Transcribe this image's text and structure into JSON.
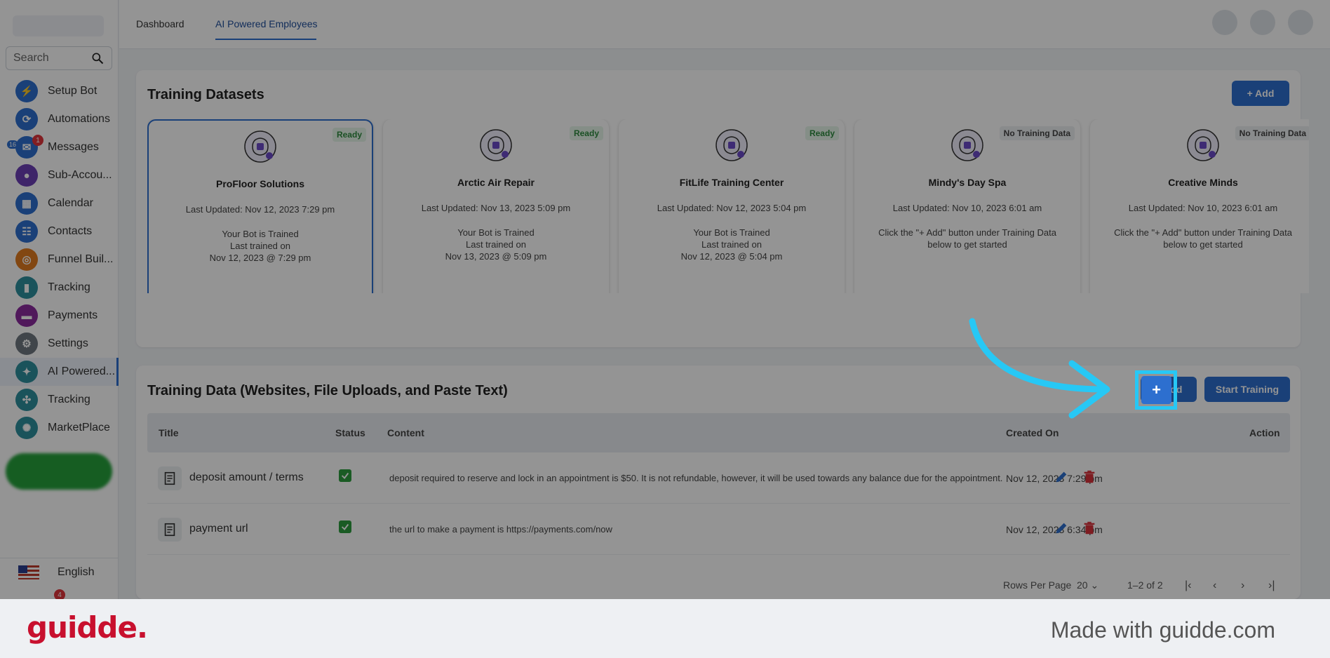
{
  "sidebar": {
    "search_placeholder": "Search",
    "items": [
      {
        "label": "Setup Bot",
        "icon": "bolt-icon",
        "color": "#2d6fcf",
        "glyph": "⚡"
      },
      {
        "label": "Automations",
        "icon": "automation-icon",
        "color": "#2d6fcf",
        "glyph": "⟳"
      },
      {
        "label": "Messages",
        "icon": "messages-icon",
        "color": "#2d6fcf",
        "glyph": "✉",
        "badge": "1",
        "badge2": "16"
      },
      {
        "label": "Sub-Accou...",
        "icon": "user-icon",
        "color": "#6b3fb5",
        "glyph": "●"
      },
      {
        "label": "Calendar",
        "icon": "calendar-icon",
        "color": "#2d6fcf",
        "glyph": "▦"
      },
      {
        "label": "Contacts",
        "icon": "contacts-icon",
        "color": "#2d6fcf",
        "glyph": "☷"
      },
      {
        "label": "Funnel Buil...",
        "icon": "funnel-icon",
        "color": "#e07b1f",
        "glyph": "◎"
      },
      {
        "label": "Tracking",
        "icon": "chart-icon",
        "color": "#2d8f9e",
        "glyph": "▮"
      },
      {
        "label": "Payments",
        "icon": "card-icon",
        "color": "#8a2a9e",
        "glyph": "▬"
      },
      {
        "label": "Settings",
        "icon": "gear-icon",
        "color": "#6e7780",
        "glyph": "⚙"
      },
      {
        "label": "AI Powered...",
        "icon": "chat-icon",
        "color": "#2d8f9e",
        "glyph": "✦",
        "active": true
      },
      {
        "label": "Tracking",
        "icon": "network-icon",
        "color": "#2d8f9e",
        "glyph": "✣"
      },
      {
        "label": "MarketPlace",
        "icon": "bulb-icon",
        "color": "#2d8f9e",
        "glyph": "✺"
      }
    ],
    "language": "English",
    "bottom_badge": "4"
  },
  "topbar": {
    "tabs": [
      "Dashboard",
      "AI Powered Employees"
    ]
  },
  "datasets": {
    "title": "Training Datasets",
    "add_label": "+ Add",
    "cards": [
      {
        "name": "ProFloor Solutions",
        "status": "Ready",
        "updated": "Last Updated: Nov 12, 2023 7:29 pm",
        "desc": "Your Bot is Trained\nLast trained on\nNov 12, 2023 @ 7:29 pm"
      },
      {
        "name": "Arctic Air Repair",
        "status": "Ready",
        "updated": "Last Updated: Nov 13, 2023 5:09 pm",
        "desc": "Your Bot is Trained\nLast trained on\nNov 13, 2023 @ 5:09 pm"
      },
      {
        "name": "FitLife Training Center",
        "status": "Ready",
        "updated": "Last Updated: Nov 12, 2023 5:04 pm",
        "desc": "Your Bot is Trained\nLast trained on\nNov 12, 2023 @ 5:04 pm"
      },
      {
        "name": "Mindy's Day Spa",
        "status": "No Training Data",
        "updated": "Last Updated: Nov 10, 2023 6:01 am",
        "desc": "Click the \"+ Add\" button under Training Data\nbelow to get started"
      },
      {
        "name": "Creative Minds",
        "status": "No Training Data",
        "updated": "Last Updated: Nov 10, 2023 6:01 am",
        "desc": "Click the \"+ Add\" button under Training Data\nbelow to get started"
      }
    ]
  },
  "training_data": {
    "title": "Training Data (Websites, File Uploads, and Paste Text)",
    "add_label": "+ Add",
    "start_label": "Start Training",
    "columns": [
      "Title",
      "Status",
      "Content",
      "Created On",
      "Action"
    ],
    "rows": [
      {
        "title": "deposit amount / terms",
        "content": "deposit required to reserve and lock in an appointment is $50. It is not refundable, however, it will be used towards any balance due for the appointment.",
        "created": "Nov 12, 2023 7:29 pm"
      },
      {
        "title": "payment url",
        "content": "the url to make a payment is https://payments.com/now",
        "created": "Nov 12, 2023 6:34 pm"
      }
    ],
    "rows_per_page_label": "Rows Per Page",
    "rows_per_page": "20",
    "range": "1–2 of 2"
  },
  "highlight": {
    "glyph": "+"
  },
  "footer": {
    "logo": "guidde.",
    "tagline": "Made with guidde.com"
  },
  "colors": {
    "accent": "#2d6fcf",
    "ready": "#2e8b3e",
    "highlight": "#27c8f5",
    "brand": "#c8102e"
  }
}
